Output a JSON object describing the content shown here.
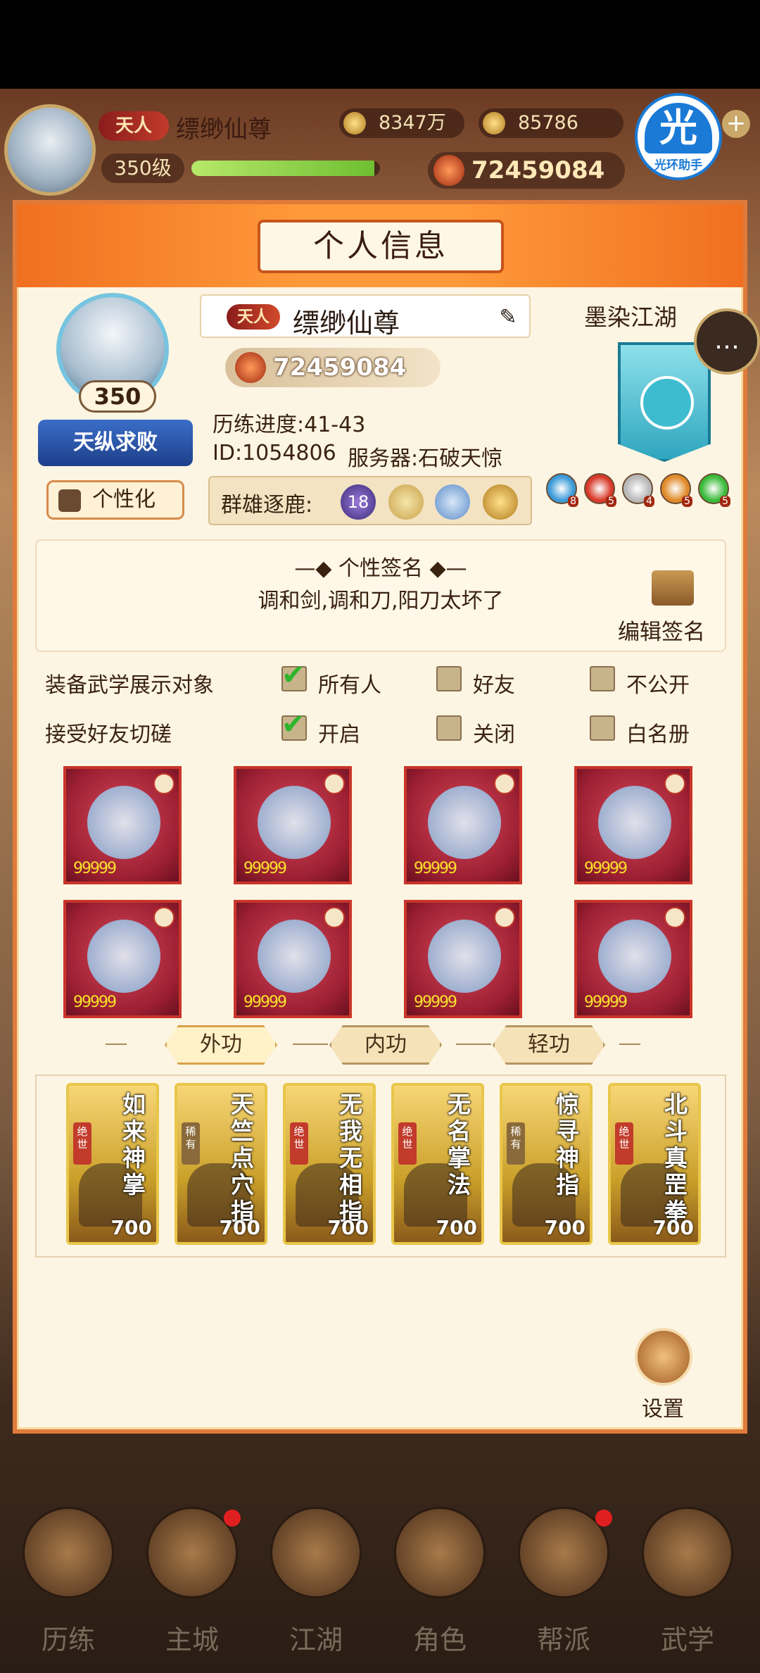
{
  "topbar": {
    "rank": "天人",
    "player_name": "缥缈仙尊",
    "silver": "8347万",
    "gold": "85786",
    "level": "350级",
    "exp_fraction": 0.97,
    "power": "72459084",
    "helper_glyph": "光",
    "helper_label": "光环助手"
  },
  "panel": {
    "title": "个人信息",
    "avatar_level": "350",
    "title_tag": "天纵求败",
    "personalize_label": "个性化",
    "rank": "天人",
    "name": "缥缈仙尊",
    "power": "72459084",
    "progress": "历练进度:41-43",
    "id_line": "ID:1054806",
    "server": "服务器:石破天惊",
    "arena_label": "群雄逐鹿:",
    "arena_rank": "18",
    "guild_name": "墨染江湖",
    "guild_gems": [
      {
        "color": "#3a9ad8",
        "count": "8"
      },
      {
        "color": "#d83a2a",
        "count": "5"
      },
      {
        "color": "#b8b8b8",
        "count": "4"
      },
      {
        "color": "#e08a2a",
        "count": "5"
      },
      {
        "color": "#3aba3a",
        "count": "5"
      }
    ]
  },
  "signature": {
    "title": "个性签名",
    "text": "调和剑,调和刀,阳刀太坏了",
    "edit_label": "编辑签名"
  },
  "options": {
    "display_label": "装备武学展示对象",
    "display_choices": [
      {
        "label": "所有人",
        "checked": true
      },
      {
        "label": "好友",
        "checked": false
      },
      {
        "label": "不公开",
        "checked": false
      }
    ],
    "spar_label": "接受好友切磋",
    "spar_choices": [
      {
        "label": "开启",
        "checked": true
      },
      {
        "label": "关闭",
        "checked": false
      },
      {
        "label": "白名册",
        "checked": false
      }
    ]
  },
  "equipment": {
    "stars_text": "99999"
  },
  "tabs": [
    "外功",
    "内功",
    "轻功"
  ],
  "skills": [
    {
      "name": "如来神掌",
      "tag": "绝世",
      "level": "700"
    },
    {
      "name": "天竺点穴指",
      "tag": "稀有",
      "level": "700"
    },
    {
      "name": "无我无相指",
      "tag": "绝世",
      "level": "700"
    },
    {
      "name": "无名掌法",
      "tag": "绝世",
      "level": "700"
    },
    {
      "name": "惊寻神指",
      "tag": "稀有",
      "level": "700"
    },
    {
      "name": "北斗真罡拳",
      "tag": "绝世",
      "level": "700"
    }
  ],
  "settings_label": "设置",
  "chat_icon": "chat-bubble-icon",
  "bottom_nav": [
    "历练",
    "主城",
    "江湖",
    "角色",
    "帮派",
    "武学"
  ]
}
